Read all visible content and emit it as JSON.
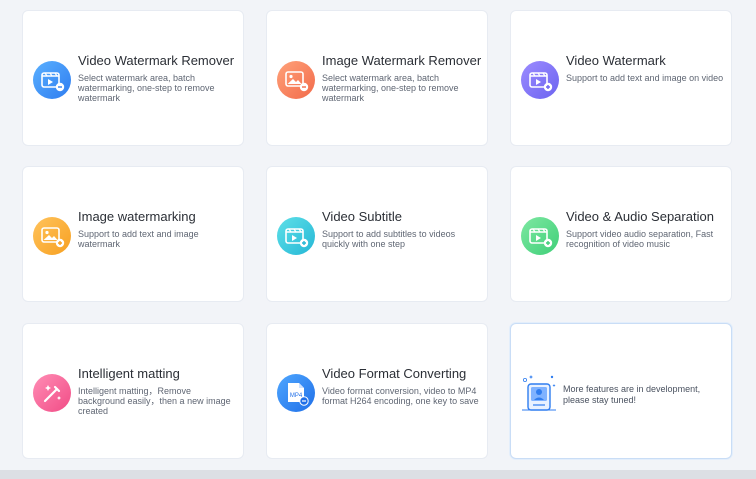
{
  "cards": [
    {
      "title": "Video Watermark Remover",
      "desc": "Select watermark area, batch watermarking, one-step to remove watermark",
      "color_from": "#5ab0ff",
      "color_to": "#2f7df0",
      "icon": "video-clapper-icon"
    },
    {
      "title": "Image Watermark Remover",
      "desc": "Select watermark area, batch watermarking, one-step to remove watermark",
      "color_from": "#ffa27a",
      "color_to": "#f26a4a",
      "icon": "image-icon"
    },
    {
      "title": "Video Watermark",
      "desc": "Support to add text and image on video",
      "color_from": "#9c8cff",
      "color_to": "#6c63f0",
      "icon": "video-clapper-icon"
    },
    {
      "title": "Image watermarking",
      "desc": "Support to add text and image watermark",
      "color_from": "#ffc35c",
      "color_to": "#f7a021",
      "icon": "image-icon"
    },
    {
      "title": "Video Subtitle",
      "desc": "Support to add subtitles to videos quickly with one step",
      "color_from": "#5ee0e8",
      "color_to": "#25b7d6",
      "icon": "video-clapper-icon"
    },
    {
      "title": "Video & Audio Separation",
      "desc": "Support video audio separation, Fast recognition of video music",
      "color_from": "#7ee8a2",
      "color_to": "#3fcf78",
      "icon": "video-clapper-icon"
    },
    {
      "title": "Intelligent matting",
      "desc": "Intelligent matting，Remove background easily，then a new image created",
      "color_from": "#ff8db5",
      "color_to": "#f14c86",
      "icon": "magic-wand-icon"
    },
    {
      "title": "Video Format Converting",
      "desc": "Video format conversion, video to MP4 format H264 encoding, one key to save",
      "color_from": "#4fa7ff",
      "color_to": "#1f6fe8",
      "icon": "mp4-file-icon",
      "badge": "MP4"
    }
  ],
  "dev_card": {
    "text": "More features are in development, please stay tuned!",
    "icon": "developer-illustration-icon"
  }
}
